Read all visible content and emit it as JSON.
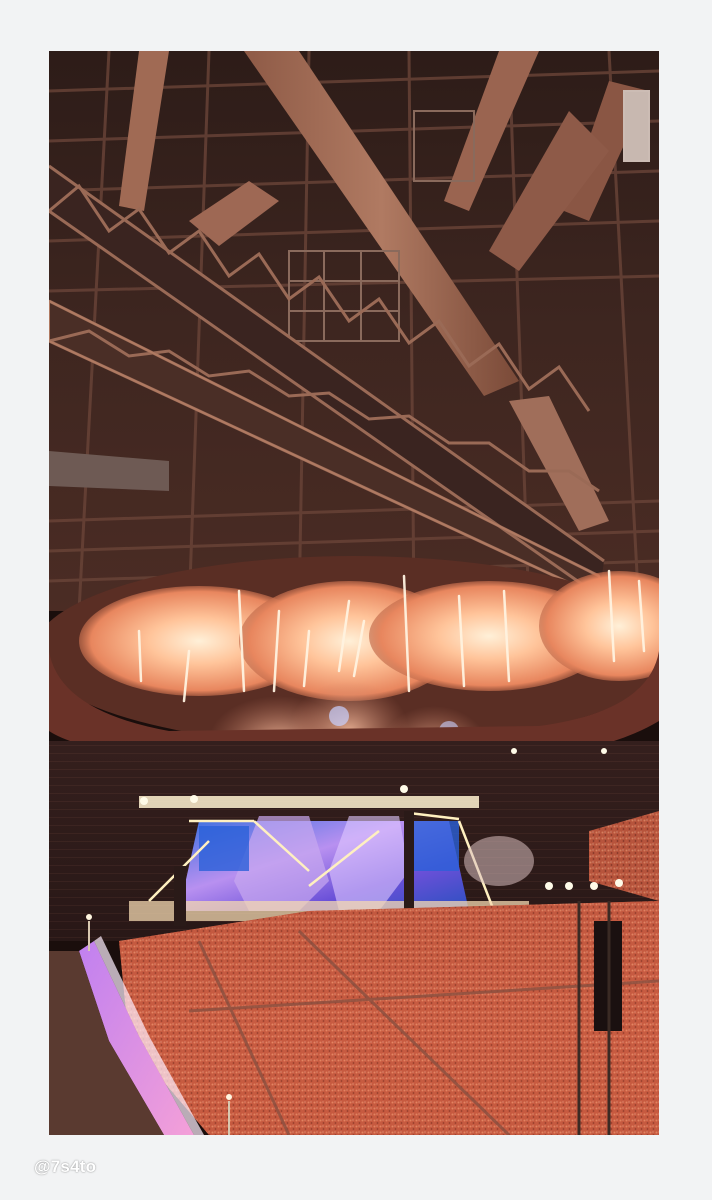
{
  "watermark": {
    "text": "@7s4to"
  },
  "photo": {
    "subject": "stadium-concert",
    "colors": {
      "frame": "#f2f3f4",
      "roof_steel": "#5a3a30",
      "roof_dark": "#2a1a16",
      "fireworks": "#ffb58a",
      "crowd": "#c8583e",
      "stage_screen": "#8a6ad8"
    }
  }
}
